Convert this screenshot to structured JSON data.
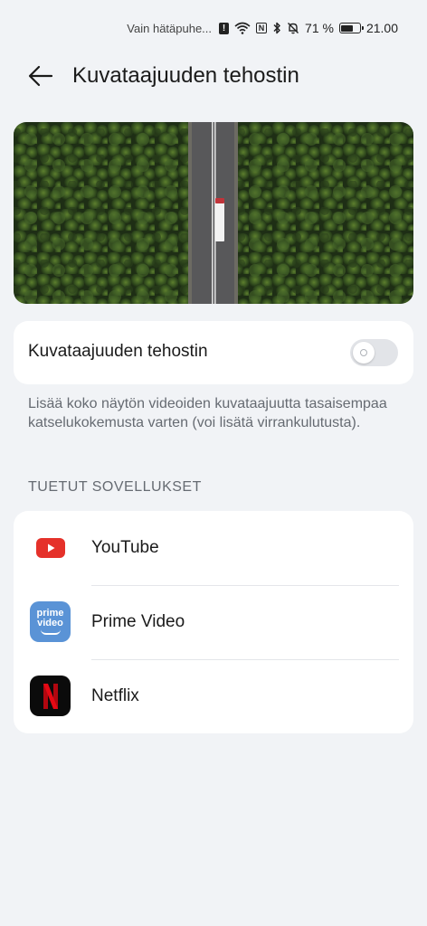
{
  "status_bar": {
    "carrier": "Vain hätäpuhe...",
    "battery_percent": "71 %",
    "battery_level": 0.71,
    "time": "21.00"
  },
  "header": {
    "title": "Kuvataajuuden tehostin"
  },
  "toggle": {
    "label": "Kuvataajuuden tehostin",
    "enabled": false
  },
  "description": "Lisää koko näytön videoiden kuvataajuutta tasaisempaa katselukokemusta varten (voi lisätä virrankulutusta).",
  "section": {
    "title": "TUETUT SOVELLUKSET"
  },
  "apps": [
    {
      "label": "YouTube",
      "icon": "youtube-icon"
    },
    {
      "label": "Prime Video",
      "icon": "prime-video-icon",
      "icon_text_top": "prime",
      "icon_text_bottom": "video"
    },
    {
      "label": "Netflix",
      "icon": "netflix-icon"
    }
  ],
  "colors": {
    "background": "#f1f3f6",
    "card": "#ffffff",
    "youtube_red": "#e5312a",
    "prime_blue": "#5a93d6",
    "netflix_red": "#e50914",
    "secondary_text": "#666b72"
  }
}
